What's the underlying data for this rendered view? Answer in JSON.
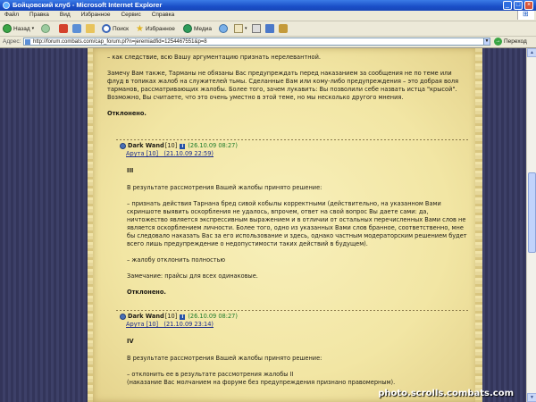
{
  "window": {
    "title": "Бойцовский клуб - Microsoft Internet Explorer",
    "buttons": {
      "minimize": "_",
      "maximize": "□",
      "close": "×"
    }
  },
  "menu": {
    "items": [
      "Файл",
      "Правка",
      "Вид",
      "Избранное",
      "Сервис",
      "Справка"
    ]
  },
  "toolbar": {
    "back": "Назад",
    "search": "Поиск",
    "favorites": "Избранное",
    "media": "Медиа"
  },
  "address": {
    "label": "Адрес:",
    "url": "http://forum.combats.com/cap_forum.pl?n=jeremiadfid=1254467551&p=8",
    "go": "Переход"
  },
  "posts": {
    "partial_top": {
      "line1": "– как следствие, всю Вашу аргументацию признать нерелевантной.",
      "para": "Замечу Вам также, Тарманы не обязаны Вас предупреждать перед наказанием за сообщения не по теме или флуд в топиках жалоб на служителей тьмы. Сделанные Вам или кому-либо предупреждения – это добрая воля тарманов, рассматривающих жалобы. Более того, зачем лукавить: Вы позволили себе назвать истца \"крысой\". Возможно, Вы считаете, что это очень уместно в этой теме, но мы несколько другого мнения.",
      "verdict": "Отклонено."
    },
    "post1": {
      "author": "Dark Wand",
      "level": "[10]",
      "date": "(26.10.09 08:27)",
      "reply_to": "Арута [10]   (21.10.09 22:59)",
      "numeral": "III",
      "intro": "В результате рассмотрения Вашей жалобы принято решение:",
      "point": "– признать действия Тарнана бред сивой кобылы корректными (действительно, на указанном Вами скриншоте выявить оскорбления не удалось, впрочем, ответ на свой вопрос Вы даете сами: да, ничтожество является экспрессивным выражением и в отличии от остальных перечисленных Вами слов не является оскорблением личности. Более того, одно из указанных Вами слов бранное, соответственно, мне бы следовало наказать Вас за его использование и здесь, однако частным модераторским решением будет всего лишь предупреждение о недопустимости таких действий в будущем).",
      "point2": "– жалобу отклонить полностью",
      "note": "Замечание: прайсы для всех одинаковые.",
      "verdict": "Отклонено."
    },
    "post2": {
      "author": "Dark Wand",
      "level": "[10]",
      "date": "(26.10.09 08:27)",
      "reply_to": "Арута [10]   (21.10.09 23:14)",
      "numeral": "IV",
      "intro": "В результате рассмотрения Вашей жалобы принято решение:",
      "point": "– отклонить ее в результате рассмотрения жалобы II\n(наказание Вас молчанием на форуме без предупреждения признано правомерным)."
    }
  },
  "watermark": "photo.scrolls.combats.com",
  "scroll": {
    "position_fraction": 0.45
  },
  "colors": {
    "parchment": "#f4e9aa",
    "titlebar": "#1a4fc8",
    "date": "#1d7a2a",
    "link": "#1a2a8c"
  }
}
